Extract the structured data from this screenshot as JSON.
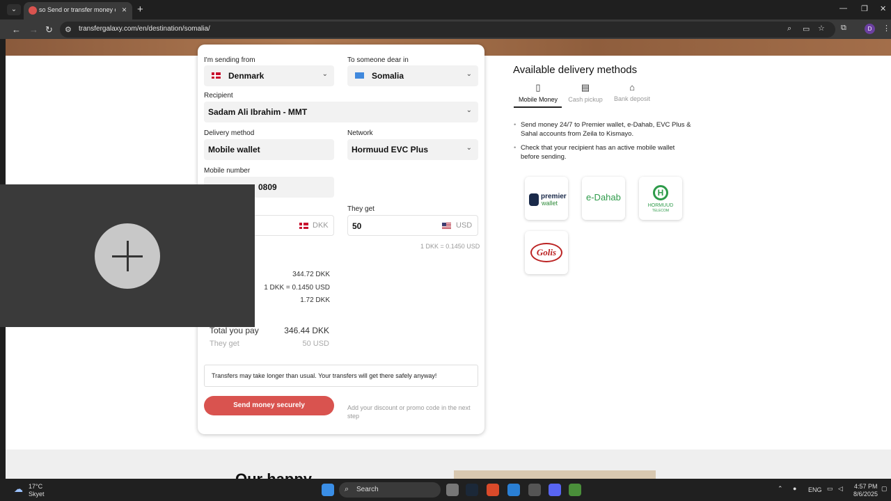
{
  "browser": {
    "tab_title": "so Send or transfer money onli",
    "url": "transfergalaxy.com/en/destination/somalia/"
  },
  "form": {
    "sending_from_label": "I'm sending from",
    "sending_from_value": "Denmark",
    "to_label": "To someone dear in",
    "to_value": "Somalia",
    "recipient_label": "Recipient",
    "recipient_value": "Sadam Ali Ibrahim - MMT",
    "delivery_label": "Delivery method",
    "delivery_value": "Mobile wallet",
    "network_label": "Network",
    "network_value": "Hormuud EVC Plus",
    "mobile_label": "Mobile number",
    "mobile_value": "0809",
    "send_currency": "DKK",
    "they_get_label": "They get",
    "they_get_value": "50",
    "they_get_currency": "USD",
    "rate_text": "1 DKK = 0.1450 USD",
    "summary_amount": "344.72 DKK",
    "summary_rate": "1 DKK = 0.1450 USD",
    "summary_fee": "1.72 DKK",
    "total_label": "Total you pay",
    "total_value": "346.44 DKK",
    "get_label": "They get",
    "get_value": "50 USD",
    "notice": "Transfers may take longer than usual. Your transfers will get there safely anyway!",
    "send_button": "Send money securely",
    "promo": "Add your discount or promo code in the next step"
  },
  "delivery": {
    "title": "Available delivery methods",
    "tabs": [
      {
        "label": "Mobile Money",
        "icon": "phone-icon"
      },
      {
        "label": "Cash pickup",
        "icon": "cash-icon"
      },
      {
        "label": "Bank deposit",
        "icon": "bank-icon"
      }
    ],
    "bullets": [
      "Send money 24/7 to Premier wallet, e-Dahab, EVC Plus & Sahal accounts from Zeila to Kismayo.",
      "Check that your recipient has an active mobile wallet before sending."
    ],
    "logos": {
      "premier_1": "premier",
      "premier_2": "wallet",
      "edahab": "e-Dahab",
      "hormuud": "HORMUUD",
      "hormuud_sub": "TELECOM",
      "golis": "Golis"
    }
  },
  "footer": {
    "heading": "Our happy customers"
  },
  "taskbar": {
    "temp": "17°C",
    "weather": "Skyet",
    "search": "Search",
    "lang": "ENG",
    "time": "4:57 PM",
    "date": "8/6/2025"
  }
}
